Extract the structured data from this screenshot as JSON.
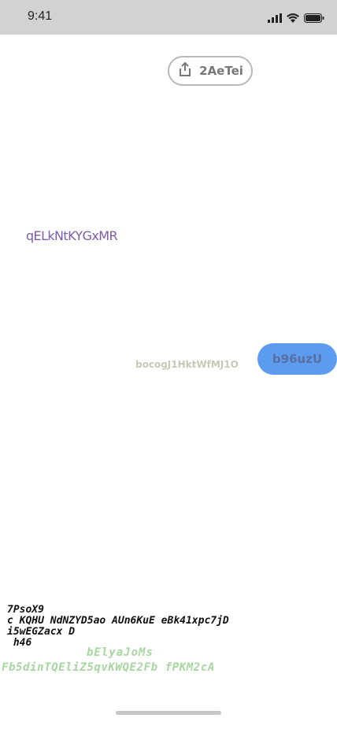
{
  "status_bar": {
    "time": "9:41",
    "icons": [
      "signal-icon",
      "wifi-icon",
      "battery-icon"
    ]
  },
  "share_button": {
    "label": "2AeTei",
    "icon": "share-icon"
  },
  "purple_text": "qELkNtKYGxMR",
  "caption": "bocogJ1HktWfMJ1O",
  "pill_button": {
    "label": "b96uzU"
  },
  "mono_block": {
    "lines": [
      "7PsoX9",
      "c KQHU NdNZYD5ao AUn6KuE eBk41xpc7jD",
      "i5wEGZacx D",
      " h46"
    ]
  },
  "green_text": {
    "line1": "bElyaJoMs",
    "line2": "Fb5dinTQEliZ5qvKWQE2Fb fPKM2cA"
  },
  "colors": {
    "status_bar_bg": "#d2d2d2",
    "accent_blue": "#5b9cf1",
    "purple": "#7c5cab",
    "green": "#a7d6a0"
  }
}
